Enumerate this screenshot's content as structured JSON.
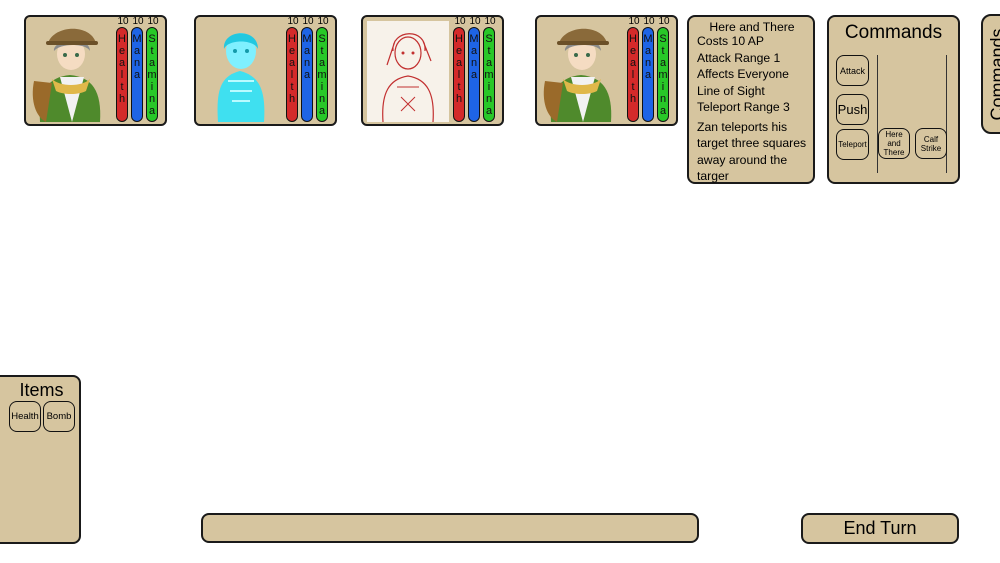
{
  "party": [
    {
      "portrait": "zan-portrait",
      "health": "10",
      "mana": "10",
      "stamina": "10",
      "style": "color"
    },
    {
      "portrait": "ghost-portrait",
      "health": "10",
      "mana": "10",
      "stamina": "10",
      "style": "cyan"
    },
    {
      "portrait": "sketch-portrait",
      "health": "10",
      "mana": "10",
      "stamina": "10",
      "style": "sketch"
    },
    {
      "portrait": "zan-portrait",
      "health": "10",
      "mana": "10",
      "stamina": "10",
      "style": "color"
    }
  ],
  "stat_labels": {
    "health": "Health",
    "mana": "Mana",
    "stamina": "Stamina"
  },
  "ability_info": {
    "title": "Here and There",
    "lines": [
      "Costs 10 AP",
      "Attack Range 1",
      "Affects Everyone",
      "Line of Sight",
      "Teleport Range 3"
    ],
    "description": "Zan teleports his target three squares away around the targer"
  },
  "commands": {
    "title": "Commands",
    "column1": [
      "Attack",
      "Push",
      "Teleport"
    ],
    "column2": [
      "Here and There",
      "Calf Strike"
    ]
  },
  "commands_tab": "Commands",
  "items": {
    "title": "Items",
    "buttons": [
      "Health",
      "Bomb"
    ]
  },
  "message_bar": "",
  "end_turn": "End Turn",
  "colors": {
    "panel": "#d6c59f",
    "health": "#d42a2a",
    "mana": "#1e64e6",
    "stamina": "#28c828",
    "border": "#1a1a1a"
  }
}
